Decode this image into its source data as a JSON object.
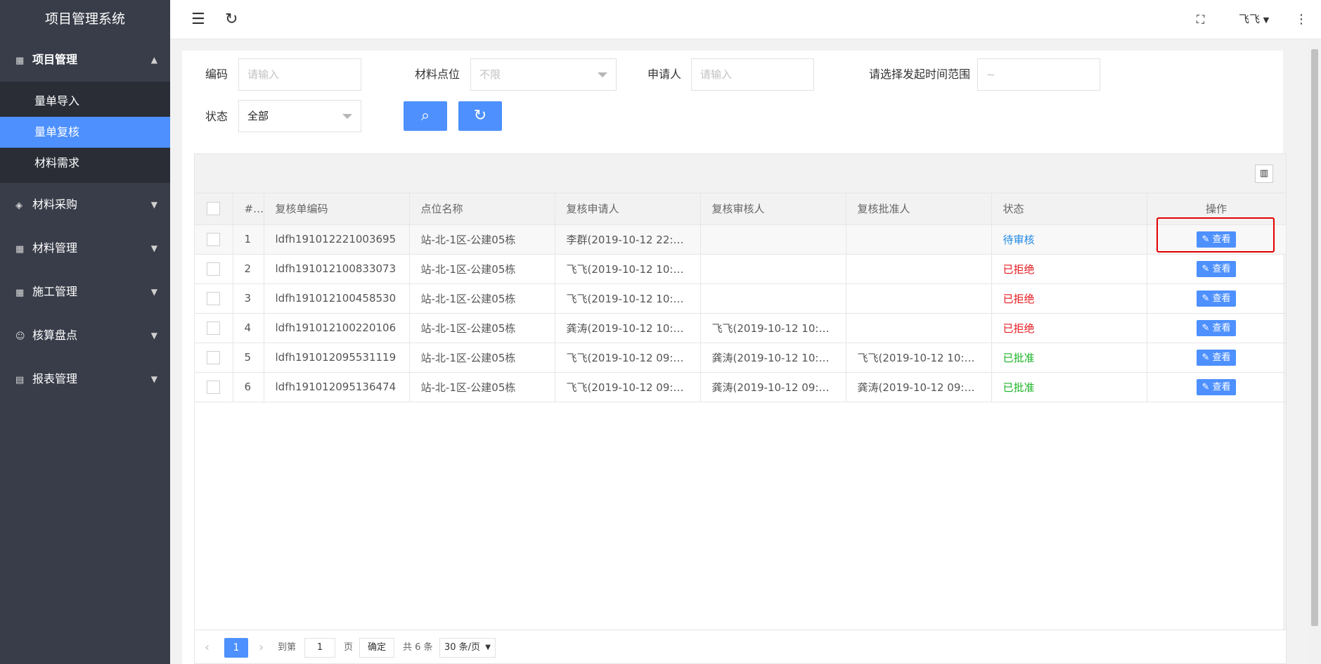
{
  "app_title": "项目管理系统",
  "sidebar": {
    "groups": [
      {
        "label": "项目管理",
        "icon": "grid-plus-icon",
        "expanded": true,
        "items": [
          {
            "label": "量单导入",
            "active": false
          },
          {
            "label": "量单复核",
            "active": true
          },
          {
            "label": "材料需求",
            "active": false
          }
        ]
      },
      {
        "label": "材料采购",
        "icon": "layers-icon"
      },
      {
        "label": "材料管理",
        "icon": "grid-plus-icon"
      },
      {
        "label": "施工管理",
        "icon": "grid-plus-icon"
      },
      {
        "label": "核算盘点",
        "icon": "user-icon"
      },
      {
        "label": "报表管理",
        "icon": "clipboard-icon"
      }
    ]
  },
  "topbar": {
    "user_name": "飞飞"
  },
  "filters": {
    "code_label": "编码",
    "code_placeholder": "请输入",
    "location_label": "材料点位",
    "location_value": "不限",
    "applicant_label": "申请人",
    "applicant_placeholder": "请输入",
    "time_label": "请选择发起时间范围",
    "time_value": "~",
    "status_label": "状态",
    "status_value": "全部"
  },
  "table": {
    "headers": [
      "#",
      "复核单编码",
      "点位名称",
      "复核申请人",
      "复核审核人",
      "复核批准人",
      "状态",
      "操作"
    ],
    "view_label": "查看",
    "rows": [
      {
        "no": "1",
        "code": "ldfh191012221003695",
        "location": "站-北-1区-公建05栋",
        "applicant": "李群(2019-10-12 22:1…",
        "reviewer": "",
        "approver": "",
        "status": "待审核",
        "status_type": "pending"
      },
      {
        "no": "2",
        "code": "ldfh191012100833073",
        "location": "站-北-1区-公建05栋",
        "applicant": "飞飞(2019-10-12 10:0…",
        "reviewer": "",
        "approver": "",
        "status": "已拒绝",
        "status_type": "rejected"
      },
      {
        "no": "3",
        "code": "ldfh191012100458530",
        "location": "站-北-1区-公建05栋",
        "applicant": "飞飞(2019-10-12 10:0…",
        "reviewer": "",
        "approver": "",
        "status": "已拒绝",
        "status_type": "rejected"
      },
      {
        "no": "4",
        "code": "ldfh191012100220106",
        "location": "站-北-1区-公建05栋",
        "applicant": "龚涛(2019-10-12 10:0…",
        "reviewer": "飞飞(2019-10-12 10:0…",
        "approver": "",
        "status": "已拒绝",
        "status_type": "rejected"
      },
      {
        "no": "5",
        "code": "ldfh191012095531119",
        "location": "站-北-1区-公建05栋",
        "applicant": "飞飞(2019-10-12 09:5…",
        "reviewer": "龚涛(2019-10-12 10:1…",
        "approver": "飞飞(2019-10-12 10:1…",
        "status": "已批准",
        "status_type": "approved"
      },
      {
        "no": "6",
        "code": "ldfh191012095136474",
        "location": "站-北-1区-公建05栋",
        "applicant": "飞飞(2019-10-12 09:5…",
        "reviewer": "龚涛(2019-10-12 09:5…",
        "approver": "龚涛(2019-10-12 09:5…",
        "status": "已批准",
        "status_type": "approved"
      }
    ]
  },
  "pager": {
    "current": "1",
    "goto_label": "到第",
    "goto_value": "1",
    "page_unit": "页",
    "confirm": "确定",
    "total": "共 6 条",
    "page_size": "30 条/页"
  },
  "colors": {
    "accent": "#4d90fe",
    "sidebar": "#393d49",
    "pending": "#1e88e5",
    "rejected": "#e6171e",
    "approved": "#1ab325",
    "highlight": "#e40000"
  }
}
